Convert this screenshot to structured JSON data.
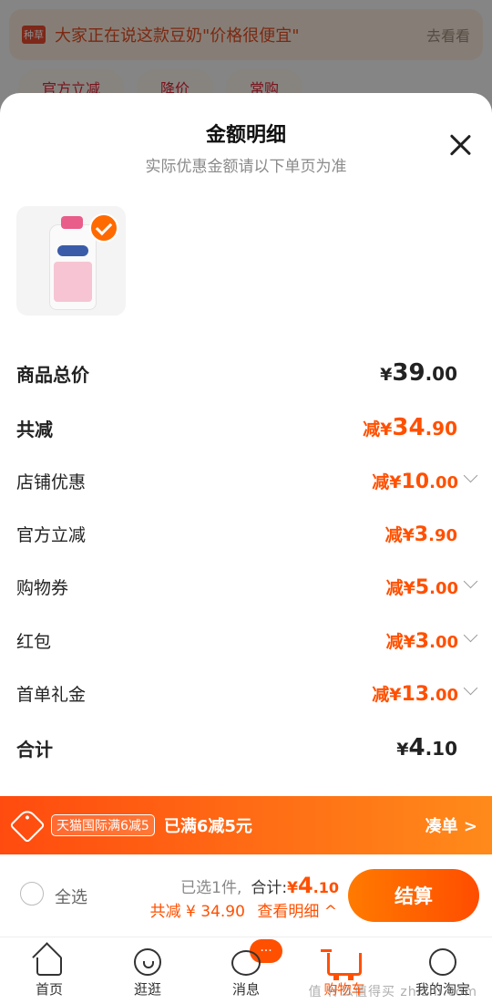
{
  "background": {
    "banner_logo": "种草",
    "banner_text": "大家正在说这款豆奶\"价格很便宜\"",
    "banner_link": "去看看",
    "chips": [
      "官方立减",
      "降价",
      "常购"
    ]
  },
  "sheet": {
    "title": "金额明细",
    "subtitle": "实际优惠金额请以下单页为准",
    "product": {
      "selected": true
    }
  },
  "rows": [
    {
      "label": "商品总价",
      "prefix": "¥",
      "int": "39",
      "dec": ".00",
      "style": "total",
      "chevron": false
    },
    {
      "label": "共减",
      "prefix": "减¥",
      "int": "34",
      "dec": ".90",
      "style": "discount-total",
      "chevron": false
    },
    {
      "label": "店铺优惠",
      "prefix": "减¥",
      "int": "10",
      "dec": ".00",
      "style": "discount",
      "chevron": true
    },
    {
      "label": "官方立减",
      "prefix": "减¥",
      "int": "3",
      "dec": ".90",
      "style": "discount",
      "chevron": false
    },
    {
      "label": "购物券",
      "prefix": "减¥",
      "int": "5",
      "dec": ".00",
      "style": "discount",
      "chevron": true
    },
    {
      "label": "红包",
      "prefix": "减¥",
      "int": "3",
      "dec": ".00",
      "style": "discount",
      "chevron": true
    },
    {
      "label": "首单礼金",
      "prefix": "减¥",
      "int": "13",
      "dec": ".00",
      "style": "discount",
      "chevron": true
    },
    {
      "label": "合计",
      "prefix": "¥",
      "int": "4",
      "dec": ".10",
      "style": "total",
      "chevron": false
    }
  ],
  "promo": {
    "pill": "天猫国际满6减5",
    "message": "已满6减5元",
    "link": "凑单 >"
  },
  "checkout": {
    "select_all": "全选",
    "selected_count": "已选1件,",
    "total_label": "合计:",
    "total_yen": "¥",
    "total_int": "4",
    "total_dec": ".10",
    "discount_text": "共减 ¥ 34.90",
    "view_details": "查看明细 ^",
    "settle_button": "结算"
  },
  "tabs": [
    {
      "label": "首页",
      "icon": "home-icon"
    },
    {
      "label": "逛逛",
      "icon": "discover-icon"
    },
    {
      "label": "消息",
      "icon": "message-icon",
      "badge": "···"
    },
    {
      "label": "购物车",
      "icon": "cart-icon",
      "active": true
    },
    {
      "label": "我的淘宝",
      "icon": "user-icon"
    }
  ],
  "watermark": "值 什么值得买 zhizhi.com",
  "colors": {
    "accent": "#ff5000",
    "text": "#222222",
    "muted": "#8a8a8a"
  }
}
